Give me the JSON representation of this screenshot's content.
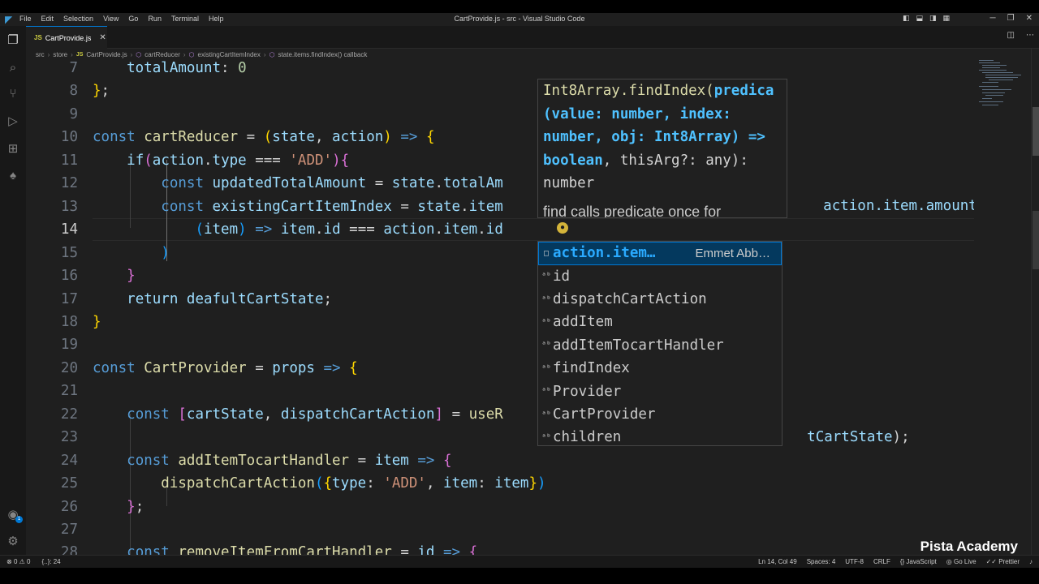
{
  "menu": [
    "File",
    "Edit",
    "Selection",
    "View",
    "Go",
    "Run",
    "Terminal",
    "Help"
  ],
  "window_title": "CartProvide.js - src - Visual Studio Code",
  "tab": {
    "label": "CartProvide.js",
    "lang": "JS"
  },
  "breadcrumb": [
    "src",
    "store",
    "CartProvide.js",
    "cartReducer",
    "existingCartItemIndex",
    "state.items.findIndex() callback"
  ],
  "lines": [
    {
      "n": "7",
      "tokens": [
        [
          "v",
          "    totalAmount"
        ],
        [
          "p",
          ": "
        ],
        [
          "n",
          "0"
        ]
      ]
    },
    {
      "n": "8",
      "tokens": [
        [
          "b1",
          "}"
        ],
        [
          "p",
          ";"
        ]
      ]
    },
    {
      "n": "9",
      "tokens": []
    },
    {
      "n": "10",
      "tokens": [
        [
          "kw",
          "const "
        ],
        [
          "f",
          "cartReducer"
        ],
        [
          "p",
          " = "
        ],
        [
          "b1",
          "("
        ],
        [
          "v",
          "state"
        ],
        [
          "p",
          ", "
        ],
        [
          "v",
          "action"
        ],
        [
          "b1",
          ")"
        ],
        [
          "kw",
          " => "
        ],
        [
          "b1",
          "{"
        ]
      ]
    },
    {
      "n": "11",
      "tokens": [
        [
          "p",
          "    "
        ],
        [
          "v",
          "if"
        ],
        [
          "b2",
          "("
        ],
        [
          "v",
          "action"
        ],
        [
          "p",
          "."
        ],
        [
          "v",
          "type"
        ],
        [
          "p",
          " === "
        ],
        [
          "s",
          "'ADD'"
        ],
        [
          "b2",
          ")"
        ],
        [
          "b2",
          "{"
        ]
      ]
    },
    {
      "n": "12",
      "tokens": [
        [
          "p",
          "        "
        ],
        [
          "kw",
          "const "
        ],
        [
          "v",
          "updatedTotalAmount"
        ],
        [
          "p",
          " = "
        ],
        [
          "v",
          "state"
        ],
        [
          "p",
          "."
        ],
        [
          "v",
          "totalAm"
        ]
      ]
    },
    {
      "n": "13",
      "tokens": [
        [
          "p",
          "        "
        ],
        [
          "kw",
          "const "
        ],
        [
          "v",
          "existingCartItemIndex"
        ],
        [
          "p",
          " = "
        ],
        [
          "v",
          "state"
        ],
        [
          "p",
          "."
        ],
        [
          "v",
          "item"
        ]
      ]
    },
    {
      "n": "14",
      "tokens": [
        [
          "p",
          "            "
        ],
        [
          "b3",
          "("
        ],
        [
          "v",
          "item"
        ],
        [
          "b3",
          ")"
        ],
        [
          "kw",
          " => "
        ],
        [
          "v",
          "item"
        ],
        [
          "p",
          "."
        ],
        [
          "v",
          "id"
        ],
        [
          "p",
          " === "
        ],
        [
          "v",
          "action"
        ],
        [
          "p",
          "."
        ],
        [
          "v",
          "item"
        ],
        [
          "p",
          "."
        ],
        [
          "v",
          "id"
        ]
      ]
    },
    {
      "n": "15",
      "tokens": [
        [
          "p",
          "        "
        ],
        [
          "b3",
          ")"
        ]
      ]
    },
    {
      "n": "16",
      "tokens": [
        [
          "p",
          "    "
        ],
        [
          "b2",
          "}"
        ]
      ]
    },
    {
      "n": "17",
      "tokens": [
        [
          "p",
          "    "
        ],
        [
          "v",
          "return "
        ],
        [
          "v",
          "deafultCartState"
        ],
        [
          "p",
          ";"
        ]
      ]
    },
    {
      "n": "18",
      "tokens": [
        [
          "b1",
          "}"
        ]
      ]
    },
    {
      "n": "19",
      "tokens": []
    },
    {
      "n": "20",
      "tokens": [
        [
          "kw",
          "const "
        ],
        [
          "f",
          "CartProvider"
        ],
        [
          "p",
          " = "
        ],
        [
          "v",
          "props"
        ],
        [
          "kw",
          " => "
        ],
        [
          "b1",
          "{"
        ]
      ]
    },
    {
      "n": "21",
      "tokens": []
    },
    {
      "n": "22",
      "tokens": [
        [
          "p",
          "    "
        ],
        [
          "kw",
          "const "
        ],
        [
          "b2",
          "["
        ],
        [
          "v",
          "cartState"
        ],
        [
          "p",
          ", "
        ],
        [
          "v",
          "dispatchCartAction"
        ],
        [
          "b2",
          "]"
        ],
        [
          "p",
          " = "
        ],
        [
          "f",
          "useR"
        ]
      ]
    },
    {
      "n": "23",
      "tokens": []
    },
    {
      "n": "24",
      "tokens": [
        [
          "p",
          "    "
        ],
        [
          "kw",
          "const "
        ],
        [
          "f",
          "addItemTocartHandler"
        ],
        [
          "p",
          " = "
        ],
        [
          "v",
          "item"
        ],
        [
          "kw",
          " => "
        ],
        [
          "b2",
          "{"
        ]
      ]
    },
    {
      "n": "25",
      "tokens": [
        [
          "p",
          "        "
        ],
        [
          "f",
          "dispatchCartAction"
        ],
        [
          "b3",
          "("
        ],
        [
          "b1",
          "{"
        ],
        [
          "v",
          "type"
        ],
        [
          "p",
          ": "
        ],
        [
          "s",
          "'ADD'"
        ],
        [
          "p",
          ", "
        ],
        [
          "v",
          "item"
        ],
        [
          "p",
          ": "
        ],
        [
          "v",
          "item"
        ],
        [
          "b1",
          "}"
        ],
        [
          "b3",
          ")"
        ]
      ]
    },
    {
      "n": "26",
      "tokens": [
        [
          "p",
          "    "
        ],
        [
          "b2",
          "}"
        ],
        [
          "p",
          ";"
        ]
      ]
    },
    {
      "n": "27",
      "tokens": []
    },
    {
      "n": "28",
      "tokens": [
        [
          "p",
          "    "
        ],
        [
          "kw",
          "const "
        ],
        [
          "f",
          "removeItemFromCartHandler"
        ],
        [
          "p",
          " = "
        ],
        [
          "v",
          "id"
        ],
        [
          "kw",
          " => "
        ],
        [
          "b2",
          "{"
        ]
      ]
    }
  ],
  "right_fragments": {
    "line12": "action.item.amount",
    "line22_pre": "t",
    "line22": "CartState",
    "line22_post": ");"
  },
  "hover": {
    "sig_name": "Int8Array.findIndex(",
    "sig_param": "predica",
    "sig_rest_1": "(value: number, index:",
    "sig_rest_2": "number, obj: Int8Array) =>",
    "sig_rest_3_t": "boolean",
    "sig_rest_3": ", thisArg?: any):",
    "sig_ret": "number",
    "doc": "find calls predicate once for"
  },
  "suggestions": [
    {
      "label": "action.item…",
      "detail": "Emmet Abb…",
      "icon": "emmet-icon",
      "selected": true
    },
    {
      "label": "id",
      "detail": "",
      "icon": "abc-icon"
    },
    {
      "label": "dispatchCartAction",
      "detail": "",
      "icon": "abc-icon"
    },
    {
      "label": "addItem",
      "detail": "",
      "icon": "abc-icon"
    },
    {
      "label": "addItemTocartHandler",
      "detail": "",
      "icon": "abc-icon"
    },
    {
      "label": "findIndex",
      "detail": "",
      "icon": "abc-icon"
    },
    {
      "label": "Provider",
      "detail": "",
      "icon": "abc-icon"
    },
    {
      "label": "CartProvider",
      "detail": "",
      "icon": "abc-icon"
    },
    {
      "label": "children",
      "detail": "",
      "icon": "abc-icon"
    }
  ],
  "status": {
    "errors": "0",
    "warnings": "0",
    "extra": "{..}: 24",
    "position": "Ln 14, Col 49",
    "spaces": "Spaces: 4",
    "encoding": "UTF-8",
    "eol": "CRLF",
    "language": "JavaScript",
    "golive": "Go Live",
    "prettier": "Prettier",
    "notif_badge": "1"
  },
  "watermark": "Pista Academy",
  "colors": {
    "accent": "#0078d4",
    "editor_bg": "#1f1f1f",
    "keyword": "#569cd6",
    "variable": "#9cdcfe",
    "string": "#ce9178",
    "function": "#dcdcaa"
  }
}
